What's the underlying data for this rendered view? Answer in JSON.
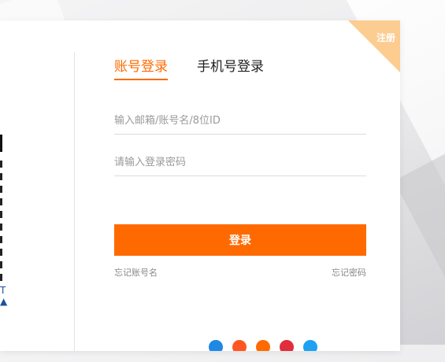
{
  "register": {
    "label": "注册"
  },
  "tabs": [
    {
      "label": "账号登录",
      "active": true
    },
    {
      "label": "手机号登录",
      "active": false
    }
  ],
  "form": {
    "account_placeholder": "输入邮箱/账号名/8位ID",
    "password_placeholder": "请输入登录密码",
    "login_button": "登录",
    "forgot_account": "忘记账号名",
    "forgot_password": "忘记密码"
  },
  "social": {
    "icons": [
      {
        "name": "social-blue-icon",
        "color": "#1e88e5"
      },
      {
        "name": "social-orange-icon",
        "color": "#ff5722"
      },
      {
        "name": "social-orange2-icon",
        "color": "#ff6a00"
      },
      {
        "name": "social-red-icon",
        "color": "#e02e3c"
      },
      {
        "name": "social-skyblue-icon",
        "color": "#1da1f2"
      }
    ]
  },
  "colors": {
    "accent": "#ff6a00",
    "ribbon": "#fccc90",
    "text": "#222222"
  }
}
